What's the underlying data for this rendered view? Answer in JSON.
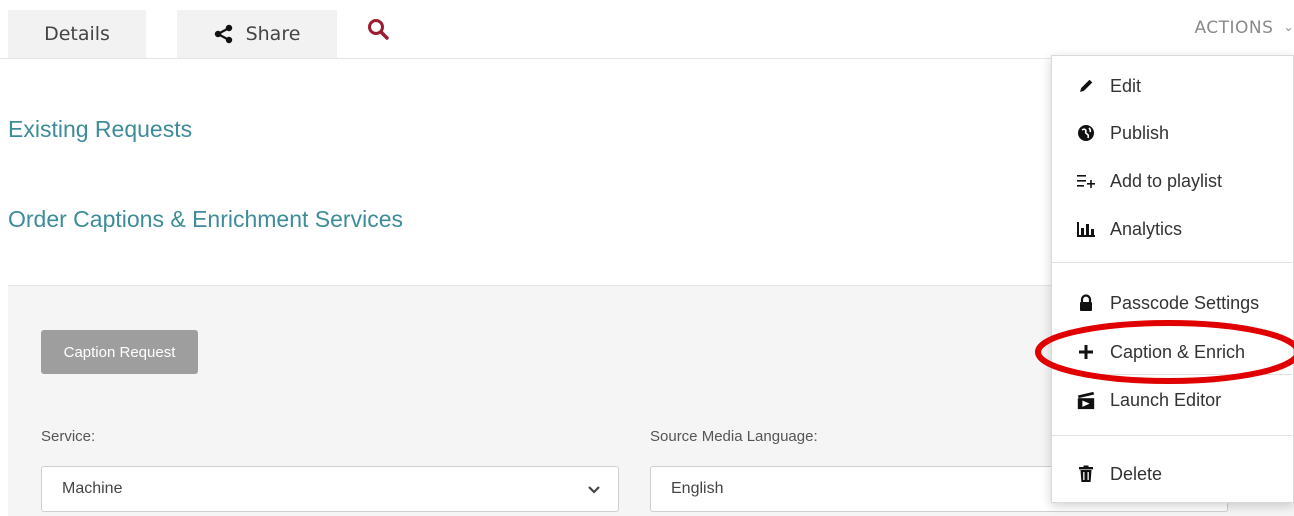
{
  "tabs": {
    "details_label": "Details",
    "share_label": "Share"
  },
  "actions_label": "ACTIONS",
  "headings": {
    "existing_requests": "Existing Requests",
    "order_services": "Order Captions & Enrichment Services"
  },
  "form": {
    "caption_request_button": "Caption Request",
    "service_label": "Service:",
    "service_value": "Machine",
    "source_language_label": "Source Media Language:",
    "source_language_value": "English"
  },
  "menu": {
    "items": [
      {
        "label": "Edit",
        "icon": "pencil-icon"
      },
      {
        "label": "Publish",
        "icon": "globe-icon"
      },
      {
        "label": "Add to playlist",
        "icon": "playlist-add-icon"
      },
      {
        "label": "Analytics",
        "icon": "bar-chart-icon"
      },
      {
        "label": "Passcode Settings",
        "icon": "lock-icon"
      },
      {
        "label": "Caption & Enrich",
        "icon": "plus-icon"
      },
      {
        "label": "Launch Editor",
        "icon": "clapperboard-icon"
      },
      {
        "label": "Delete",
        "icon": "trash-icon"
      }
    ]
  },
  "colors": {
    "heading_teal": "#3d8c99",
    "search_icon_red": "#9b1c2e",
    "highlight_red": "#e00000",
    "button_gray": "#9e9e9e",
    "panel_bg": "#f5f5f5"
  }
}
